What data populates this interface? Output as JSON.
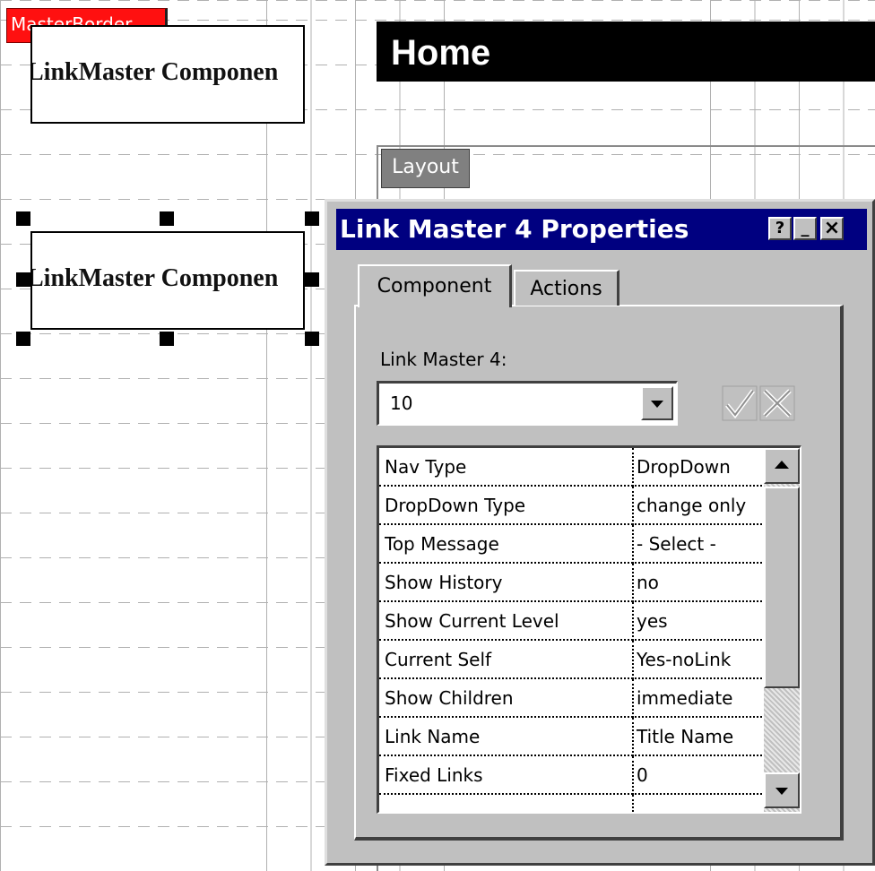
{
  "canvas": {
    "master_border_label": "MasterBorder",
    "component_1_text": "LinkMaster Componen",
    "component_2_text": "LinkMaster Componen",
    "home_title": "Home",
    "layout_tab": "Layout"
  },
  "dialog": {
    "title": "Link Master 4 Properties",
    "buttons": {
      "help": "?",
      "minimize": "_",
      "close": "×"
    },
    "tabs": [
      {
        "label": "Component",
        "active": true
      },
      {
        "label": "Actions",
        "active": false
      }
    ],
    "field_label": "Link Master 4:",
    "select_value": "10",
    "icons": [
      "check-icon",
      "x-icon"
    ],
    "properties": [
      {
        "name": "Nav Type",
        "value": "DropDown"
      },
      {
        "name": "DropDown Type",
        "value": "change only"
      },
      {
        "name": "Top Message",
        "value": "- Select -"
      },
      {
        "name": "Show History",
        "value": "no"
      },
      {
        "name": "Show Current Level",
        "value": "yes"
      },
      {
        "name": "Current Self",
        "value": "Yes-noLink"
      },
      {
        "name": "Show Children",
        "value": "immediate"
      },
      {
        "name": "Link Name",
        "value": "Title Name"
      },
      {
        "name": "Fixed Links",
        "value": "0"
      }
    ]
  },
  "colors": {
    "titlebar": "#000080",
    "dialog_face": "#c0c0c0",
    "master_border": "#ff1010",
    "home_bar": "#000000"
  }
}
